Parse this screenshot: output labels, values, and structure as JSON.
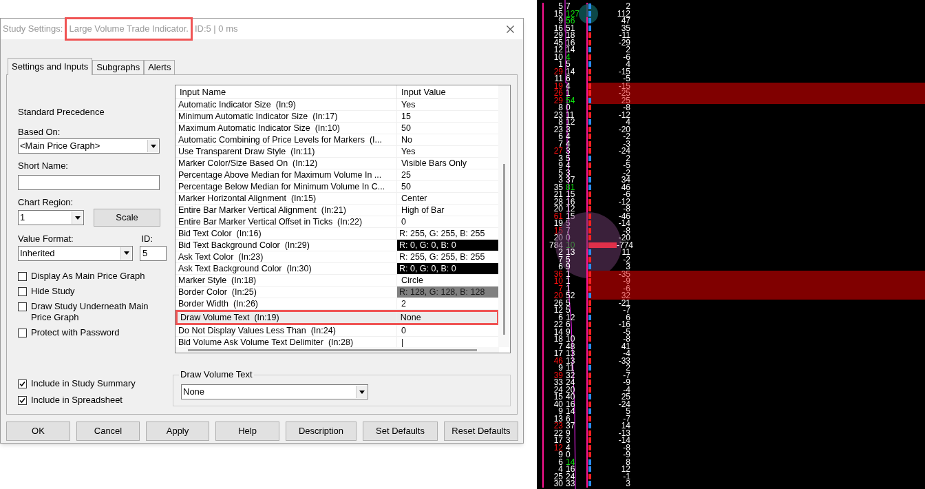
{
  "window": {
    "title_prefix": "Study Settings:",
    "title_name": "Large Volume Trade Indicator.",
    "title_suffix": "ID:5 | 0 ms",
    "title_name_highlighted": true
  },
  "tabs": [
    {
      "label": "Settings and Inputs",
      "selected": true
    },
    {
      "label": "Subgraphs",
      "selected": false
    },
    {
      "label": "Alerts",
      "selected": false
    }
  ],
  "settings": {
    "heading": "Standard Precedence",
    "based_on": {
      "label": "Based On:",
      "value": "<Main Price Graph>"
    },
    "short_name": {
      "label": "Short Name:"
    },
    "chart_region": {
      "label": "Chart Region:",
      "value": "1"
    },
    "scale_button": "Scale",
    "value_format": {
      "label": "Value Format:",
      "value": "Inherited"
    },
    "id": {
      "label": "ID:",
      "value": "5"
    },
    "options": [
      {
        "label": "Display As Main Price Graph",
        "checked": false
      },
      {
        "label": "Hide Study",
        "checked": false
      },
      {
        "label": "Draw Study Underneath Main Price Graph",
        "checked": false
      },
      {
        "label": "Protect with Password",
        "checked": false
      }
    ],
    "summary_options": [
      {
        "label": "Include in Study Summary",
        "checked": true
      },
      {
        "label": "Include in Spreadsheet",
        "checked": true
      }
    ]
  },
  "inputs": {
    "columns": [
      "Input Name",
      "Input Value"
    ],
    "rows": [
      {
        "name": "Automatic Indicator Size  (In:9)",
        "value": "Yes",
        "kind": "text",
        "selected": false,
        "highlighted": false
      },
      {
        "name": "Minimum Automatic Indicator Size  (In:17)",
        "value": "15",
        "kind": "text",
        "selected": false,
        "highlighted": false
      },
      {
        "name": "Maximum Automatic Indicator Size  (In:10)",
        "value": "50",
        "kind": "text",
        "selected": false,
        "highlighted": false
      },
      {
        "name": "Automatic Combining of Price Levels for Markers  (I...",
        "value": "No",
        "kind": "text",
        "selected": false,
        "highlighted": false
      },
      {
        "name": "Use Transparent Draw Style  (In:11)",
        "value": "Yes",
        "kind": "text",
        "selected": false,
        "highlighted": false
      },
      {
        "name": "Marker Color/Size Based On  (In:12)",
        "value": "Visible Bars Only",
        "kind": "text",
        "selected": false,
        "highlighted": false
      },
      {
        "name": "Percentage Above Median for Maximum Volume In ...",
        "value": "25",
        "kind": "text",
        "selected": false,
        "highlighted": false
      },
      {
        "name": "Percentage Below Median for Minimum Volume In C...",
        "value": "50",
        "kind": "text",
        "selected": false,
        "highlighted": false
      },
      {
        "name": "Marker Horizontal Alignment  (In:15)",
        "value": "Center",
        "kind": "text",
        "selected": false,
        "highlighted": false
      },
      {
        "name": "Entire Bar Marker Vertical Alignment  (In:21)",
        "value": "High of Bar",
        "kind": "text",
        "selected": false,
        "highlighted": false
      },
      {
        "name": "Entire Bar Marker Vertical Offset in Ticks  (In:22)",
        "value": "0",
        "kind": "text",
        "selected": false,
        "highlighted": false
      },
      {
        "name": "Bid Text Color  (In:16)",
        "value": "R: 255, G: 255, B: 255",
        "kind": "color",
        "color": "#ffffff",
        "selected": false,
        "highlighted": false
      },
      {
        "name": "Bid Text Background Color  (In:29)",
        "value": "R: 0, G: 0, B: 0",
        "kind": "color",
        "color": "#000000",
        "selected": false,
        "highlighted": false
      },
      {
        "name": "Ask Text Color  (In:23)",
        "value": "R: 255, G: 255, B: 255",
        "kind": "color",
        "color": "#ffffff",
        "selected": false,
        "highlighted": false
      },
      {
        "name": "Ask Text Background Color  (In:30)",
        "value": "R: 0, G: 0, B: 0",
        "kind": "color",
        "color": "#000000",
        "selected": false,
        "highlighted": false
      },
      {
        "name": "Marker Style  (In:18)",
        "value": "Circle",
        "kind": "text",
        "selected": false,
        "highlighted": false
      },
      {
        "name": "Border Color  (In:25)",
        "value": "R: 128, G: 128, B: 128",
        "kind": "color",
        "color": "#808080",
        "selected": false,
        "highlighted": false
      },
      {
        "name": "Border Width  (In:26)",
        "value": "2",
        "kind": "text",
        "selected": false,
        "highlighted": false
      },
      {
        "name": "Draw Volume Text  (In:19)",
        "value": "None",
        "kind": "text",
        "selected": true,
        "highlighted": true
      },
      {
        "name": "Do Not Display Values Less Than  (In:24)",
        "value": "0",
        "kind": "text",
        "selected": false,
        "highlighted": false
      },
      {
        "name": "Bid Volume Ask Volume Text Delimiter  (In:28)",
        "value": "|",
        "kind": "text",
        "selected": false,
        "highlighted": false
      }
    ]
  },
  "editor": {
    "label": "Draw Volume Text",
    "value": "None"
  },
  "buttons": [
    "OK",
    "Cancel",
    "Apply",
    "Help",
    "Description",
    "Set Defaults",
    "Reset Defaults"
  ],
  "chart": {
    "rows": [
      {
        "bid": "5",
        "ask": "7",
        "delta": "2",
        "bid_flag": false,
        "ask_flag": false,
        "up": true,
        "highlighted": false,
        "kind": "marker"
      },
      {
        "bid": "15",
        "ask": "127",
        "delta": "112",
        "bid_flag": false,
        "ask_flag": true,
        "up": true,
        "highlighted": false,
        "kind": "marker",
        "circled": true
      },
      {
        "bid": "9",
        "ask": "56",
        "delta": "47",
        "bid_flag": false,
        "ask_flag": true,
        "up": true,
        "highlighted": false,
        "kind": "marker"
      },
      {
        "bid": "16",
        "ask": "51",
        "delta": "35",
        "bid_flag": false,
        "ask_flag": false,
        "up": true,
        "highlighted": false,
        "kind": "marker"
      },
      {
        "bid": "29",
        "ask": "18",
        "delta": "-11",
        "bid_flag": false,
        "ask_flag": false,
        "up": false,
        "highlighted": false,
        "kind": "marker"
      },
      {
        "bid": "45",
        "ask": "16",
        "delta": "-29",
        "bid_flag": false,
        "ask_flag": false,
        "up": false,
        "highlighted": false,
        "kind": "marker"
      },
      {
        "bid": "12",
        "ask": "14",
        "delta": "2",
        "bid_flag": false,
        "ask_flag": false,
        "up": true,
        "highlighted": false,
        "kind": "marker"
      },
      {
        "bid": "10",
        "ask": "4",
        "delta": "-6",
        "bid_flag": false,
        "ask_flag": true,
        "up": false,
        "highlighted": false,
        "kind": "marker"
      },
      {
        "bid": "1",
        "ask": "5",
        "delta": "4",
        "bid_flag": false,
        "ask_flag": false,
        "up": true,
        "highlighted": false,
        "kind": "marker"
      },
      {
        "bid": "29",
        "ask": "14",
        "delta": "-15",
        "bid_flag": true,
        "ask_flag": false,
        "up": false,
        "highlighted": false,
        "kind": "marker"
      },
      {
        "bid": "11",
        "ask": "6",
        "delta": "-5",
        "bid_flag": false,
        "ask_flag": false,
        "up": false,
        "highlighted": false,
        "kind": "marker"
      },
      {
        "bid": "19",
        "ask": "4",
        "delta": "-15",
        "bid_flag": true,
        "ask_flag": false,
        "up": false,
        "highlighted": true,
        "kind": "marker"
      },
      {
        "bid": "26",
        "ask": "1",
        "delta": "-25",
        "bid_flag": true,
        "ask_flag": false,
        "up": false,
        "highlighted": true,
        "kind": "marker"
      },
      {
        "bid": "29",
        "ask": "54",
        "delta": "25",
        "bid_flag": true,
        "ask_flag": true,
        "up": true,
        "highlighted": true,
        "kind": "marker"
      },
      {
        "bid": "8",
        "ask": "0",
        "delta": "-8",
        "bid_flag": false,
        "ask_flag": false,
        "up": false,
        "highlighted": false,
        "kind": "marker"
      },
      {
        "bid": "23",
        "ask": "11",
        "delta": "-12",
        "bid_flag": false,
        "ask_flag": false,
        "up": false,
        "highlighted": false,
        "kind": "marker"
      },
      {
        "bid": "8",
        "ask": "12",
        "delta": "4",
        "bid_flag": false,
        "ask_flag": false,
        "up": true,
        "highlighted": false,
        "kind": "marker"
      },
      {
        "bid": "23",
        "ask": "3",
        "delta": "-20",
        "bid_flag": false,
        "ask_flag": false,
        "up": false,
        "highlighted": false,
        "kind": "marker"
      },
      {
        "bid": "6",
        "ask": "4",
        "delta": "-2",
        "bid_flag": false,
        "ask_flag": false,
        "up": false,
        "highlighted": false,
        "kind": "marker"
      },
      {
        "bid": "7",
        "ask": "4",
        "delta": "-3",
        "bid_flag": false,
        "ask_flag": false,
        "up": false,
        "highlighted": false,
        "kind": "marker"
      },
      {
        "bid": "27",
        "ask": "3",
        "delta": "-24",
        "bid_flag": true,
        "ask_flag": false,
        "up": false,
        "highlighted": false,
        "kind": "marker"
      },
      {
        "bid": "3",
        "ask": "5",
        "delta": "2",
        "bid_flag": false,
        "ask_flag": false,
        "up": true,
        "highlighted": false,
        "kind": "marker"
      },
      {
        "bid": "9",
        "ask": "4",
        "delta": "-5",
        "bid_flag": false,
        "ask_flag": false,
        "up": false,
        "highlighted": false,
        "kind": "marker"
      },
      {
        "bid": "5",
        "ask": "3",
        "delta": "-2",
        "bid_flag": false,
        "ask_flag": false,
        "up": false,
        "highlighted": false,
        "kind": "marker"
      },
      {
        "bid": "3",
        "ask": "37",
        "delta": "34",
        "bid_flag": false,
        "ask_flag": false,
        "up": true,
        "highlighted": false,
        "kind": "marker"
      },
      {
        "bid": "35",
        "ask": "81",
        "delta": "46",
        "bid_flag": false,
        "ask_flag": true,
        "up": true,
        "highlighted": false,
        "kind": "marker"
      },
      {
        "bid": "21",
        "ask": "15",
        "delta": "-6",
        "bid_flag": false,
        "ask_flag": false,
        "up": false,
        "highlighted": false,
        "kind": "marker"
      },
      {
        "bid": "28",
        "ask": "16",
        "delta": "-12",
        "bid_flag": false,
        "ask_flag": false,
        "up": false,
        "highlighted": false,
        "kind": "marker"
      },
      {
        "bid": "20",
        "ask": "12",
        "delta": "-8",
        "bid_flag": false,
        "ask_flag": false,
        "up": false,
        "highlighted": false,
        "kind": "marker"
      },
      {
        "bid": "61",
        "ask": "15",
        "delta": "-46",
        "bid_flag": true,
        "ask_flag": false,
        "up": false,
        "highlighted": false,
        "kind": "marker"
      },
      {
        "bid": "19",
        "ask": "5",
        "delta": "-14",
        "bid_flag": false,
        "ask_flag": false,
        "up": false,
        "highlighted": false,
        "kind": "marker"
      },
      {
        "bid": "15",
        "ask": "7",
        "delta": "-8",
        "bid_flag": true,
        "ask_flag": false,
        "up": false,
        "highlighted": false,
        "kind": "marker"
      },
      {
        "bid": "20",
        "ask": "0",
        "delta": "-20",
        "bid_flag": false,
        "ask_flag": false,
        "up": false,
        "highlighted": false,
        "kind": "marker"
      },
      {
        "bid": "784",
        "ask": "10",
        "delta": "-774",
        "bid_flag": false,
        "ask_flag": true,
        "up": false,
        "highlighted": false,
        "kind": "large",
        "circled": true
      },
      {
        "bid": "2",
        "ask": "13",
        "delta": "11",
        "bid_flag": false,
        "ask_flag": false,
        "up": true,
        "highlighted": false,
        "kind": "marker"
      },
      {
        "bid": "7",
        "ask": "5",
        "delta": "-2",
        "bid_flag": false,
        "ask_flag": false,
        "up": false,
        "highlighted": false,
        "kind": "marker"
      },
      {
        "bid": "6",
        "ask": "9",
        "delta": "3",
        "bid_flag": false,
        "ask_flag": false,
        "up": true,
        "highlighted": false,
        "kind": "marker"
      },
      {
        "bid": "36",
        "ask": "1",
        "delta": "-35",
        "bid_flag": true,
        "ask_flag": false,
        "up": false,
        "highlighted": true,
        "kind": "marker"
      },
      {
        "bid": "10",
        "ask": "1",
        "delta": "-9",
        "bid_flag": true,
        "ask_flag": false,
        "up": false,
        "highlighted": true,
        "kind": "marker"
      },
      {
        "bid": "7",
        "ask": "1",
        "delta": "-6",
        "bid_flag": true,
        "ask_flag": false,
        "up": false,
        "highlighted": true,
        "kind": "marker"
      },
      {
        "bid": "20",
        "ask": "52",
        "delta": "32",
        "bid_flag": true,
        "ask_flag": false,
        "up": true,
        "highlighted": true,
        "kind": "marker"
      },
      {
        "bid": "26",
        "ask": "5",
        "delta": "-21",
        "bid_flag": false,
        "ask_flag": false,
        "up": false,
        "highlighted": false,
        "kind": "marker"
      },
      {
        "bid": "12",
        "ask": "5",
        "delta": "-7",
        "bid_flag": false,
        "ask_flag": false,
        "up": false,
        "highlighted": false,
        "kind": "marker"
      },
      {
        "bid": "6",
        "ask": "12",
        "delta": "6",
        "bid_flag": false,
        "ask_flag": false,
        "up": true,
        "highlighted": false,
        "kind": "marker"
      },
      {
        "bid": "22",
        "ask": "6",
        "delta": "-16",
        "bid_flag": false,
        "ask_flag": false,
        "up": false,
        "highlighted": false,
        "kind": "marker"
      },
      {
        "bid": "14",
        "ask": "9",
        "delta": "-5",
        "bid_flag": false,
        "ask_flag": false,
        "up": false,
        "highlighted": false,
        "kind": "marker"
      },
      {
        "bid": "18",
        "ask": "10",
        "delta": "-8",
        "bid_flag": false,
        "ask_flag": false,
        "up": false,
        "highlighted": false,
        "kind": "marker"
      },
      {
        "bid": "7",
        "ask": "48",
        "delta": "41",
        "bid_flag": false,
        "ask_flag": false,
        "up": true,
        "highlighted": false,
        "kind": "marker"
      },
      {
        "bid": "17",
        "ask": "13",
        "delta": "-4",
        "bid_flag": false,
        "ask_flag": false,
        "up": false,
        "highlighted": false,
        "kind": "marker"
      },
      {
        "bid": "46",
        "ask": "13",
        "delta": "-33",
        "bid_flag": true,
        "ask_flag": false,
        "up": false,
        "highlighted": false,
        "kind": "marker"
      },
      {
        "bid": "9",
        "ask": "11",
        "delta": "2",
        "bid_flag": false,
        "ask_flag": false,
        "up": true,
        "highlighted": false,
        "kind": "marker"
      },
      {
        "bid": "39",
        "ask": "32",
        "delta": "-7",
        "bid_flag": true,
        "ask_flag": false,
        "up": false,
        "highlighted": false,
        "kind": "marker"
      },
      {
        "bid": "33",
        "ask": "24",
        "delta": "-9",
        "bid_flag": false,
        "ask_flag": false,
        "up": false,
        "highlighted": false,
        "kind": "marker"
      },
      {
        "bid": "24",
        "ask": "20",
        "delta": "-4",
        "bid_flag": false,
        "ask_flag": false,
        "up": false,
        "highlighted": false,
        "kind": "marker"
      },
      {
        "bid": "15",
        "ask": "40",
        "delta": "25",
        "bid_flag": false,
        "ask_flag": false,
        "up": true,
        "highlighted": false,
        "kind": "marker"
      },
      {
        "bid": "40",
        "ask": "16",
        "delta": "-24",
        "bid_flag": false,
        "ask_flag": false,
        "up": false,
        "highlighted": false,
        "kind": "marker"
      },
      {
        "bid": "9",
        "ask": "14",
        "delta": "5",
        "bid_flag": false,
        "ask_flag": false,
        "up": true,
        "highlighted": false,
        "kind": "marker"
      },
      {
        "bid": "13",
        "ask": "6",
        "delta": "-7",
        "bid_flag": false,
        "ask_flag": false,
        "up": false,
        "highlighted": false,
        "kind": "marker"
      },
      {
        "bid": "23",
        "ask": "37",
        "delta": "14",
        "bid_flag": true,
        "ask_flag": false,
        "up": true,
        "highlighted": false,
        "kind": "marker"
      },
      {
        "bid": "22",
        "ask": "9",
        "delta": "-13",
        "bid_flag": false,
        "ask_flag": false,
        "up": false,
        "highlighted": false,
        "kind": "marker"
      },
      {
        "bid": "17",
        "ask": "3",
        "delta": "-14",
        "bid_flag": false,
        "ask_flag": false,
        "up": false,
        "highlighted": false,
        "kind": "marker"
      },
      {
        "bid": "12",
        "ask": "4",
        "delta": "-8",
        "bid_flag": true,
        "ask_flag": false,
        "up": false,
        "highlighted": false,
        "kind": "marker"
      },
      {
        "bid": "9",
        "ask": "0",
        "delta": "-9",
        "bid_flag": false,
        "ask_flag": false,
        "up": false,
        "highlighted": false,
        "kind": "marker"
      },
      {
        "bid": "6",
        "ask": "14",
        "delta": "8",
        "bid_flag": false,
        "ask_flag": true,
        "up": true,
        "highlighted": false,
        "kind": "marker"
      },
      {
        "bid": "4",
        "ask": "16",
        "delta": "12",
        "bid_flag": false,
        "ask_flag": false,
        "up": true,
        "highlighted": false,
        "kind": "marker"
      },
      {
        "bid": "25",
        "ask": "24",
        "delta": "-1",
        "bid_flag": false,
        "ask_flag": false,
        "up": false,
        "highlighted": false,
        "kind": "marker"
      },
      {
        "bid": "30",
        "ask": "33",
        "delta": "3",
        "bid_flag": false,
        "ask_flag": false,
        "up": true,
        "highlighted": false,
        "kind": "marker"
      }
    ]
  }
}
